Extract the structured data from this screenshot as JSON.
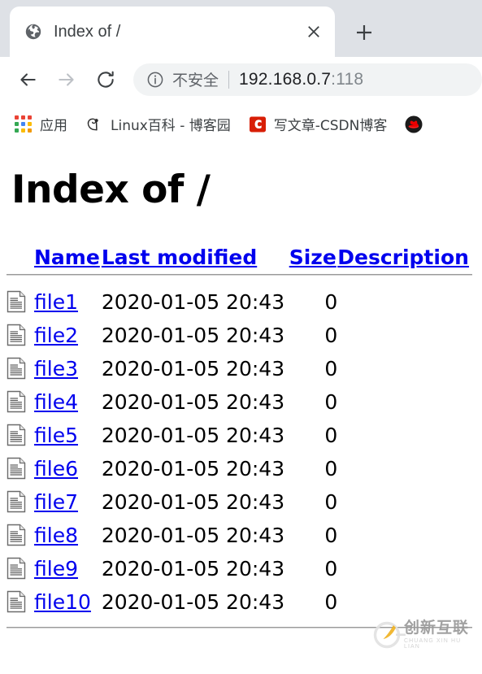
{
  "browser": {
    "tab": {
      "favicon": "globe-icon",
      "title": "Index of /",
      "close_label": "×",
      "newtab_label": "+"
    },
    "toolbar": {
      "back_label": "←",
      "forward_label": "→",
      "reload_label": "⟳",
      "security_icon": "info-circle-icon",
      "security_text": "不安全",
      "url_host": "192.168.0.7",
      "url_port": ":118"
    },
    "bookmarks": [
      {
        "icon": "apps-grid-icon",
        "label": "应用"
      },
      {
        "icon": "cnblogs-icon",
        "label": "Linux百科 - 博客园"
      },
      {
        "icon": "csdn-icon",
        "label": "写文章-CSDN博客"
      },
      {
        "icon": "redhat-icon",
        "label": ""
      }
    ]
  },
  "colors": {
    "tabstrip_bg": "#dee1e6",
    "omnibox_bg": "#f1f3f4",
    "link": "#0000ee",
    "csdn_red": "#d81e06",
    "watermark_yellow": "#f0b323",
    "watermark_gray": "#9a9a9a"
  },
  "page": {
    "title": "Index of /",
    "columns": [
      {
        "label": "Name",
        "name": "name"
      },
      {
        "label": "Last modified",
        "name": "last-modified"
      },
      {
        "label": "Size",
        "name": "size"
      },
      {
        "label": "Description",
        "name": "description"
      }
    ],
    "rows": [
      {
        "icon": "text-file-icon",
        "name": "file1",
        "last_modified": "2020-01-05 20:43",
        "size": "0",
        "description": ""
      },
      {
        "icon": "text-file-icon",
        "name": "file2",
        "last_modified": "2020-01-05 20:43",
        "size": "0",
        "description": ""
      },
      {
        "icon": "text-file-icon",
        "name": "file3",
        "last_modified": "2020-01-05 20:43",
        "size": "0",
        "description": ""
      },
      {
        "icon": "text-file-icon",
        "name": "file4",
        "last_modified": "2020-01-05 20:43",
        "size": "0",
        "description": ""
      },
      {
        "icon": "text-file-icon",
        "name": "file5",
        "last_modified": "2020-01-05 20:43",
        "size": "0",
        "description": ""
      },
      {
        "icon": "text-file-icon",
        "name": "file6",
        "last_modified": "2020-01-05 20:43",
        "size": "0",
        "description": ""
      },
      {
        "icon": "text-file-icon",
        "name": "file7",
        "last_modified": "2020-01-05 20:43",
        "size": "0",
        "description": ""
      },
      {
        "icon": "text-file-icon",
        "name": "file8",
        "last_modified": "2020-01-05 20:43",
        "size": "0",
        "description": ""
      },
      {
        "icon": "text-file-icon",
        "name": "file9",
        "last_modified": "2020-01-05 20:43",
        "size": "0",
        "description": ""
      },
      {
        "icon": "text-file-icon",
        "name": "file10",
        "last_modified": "2020-01-05 20:43",
        "size": "0",
        "description": ""
      }
    ]
  },
  "watermark": {
    "cn": "创新互联",
    "pinyin": "CHUANG XIN HU LIAN"
  }
}
